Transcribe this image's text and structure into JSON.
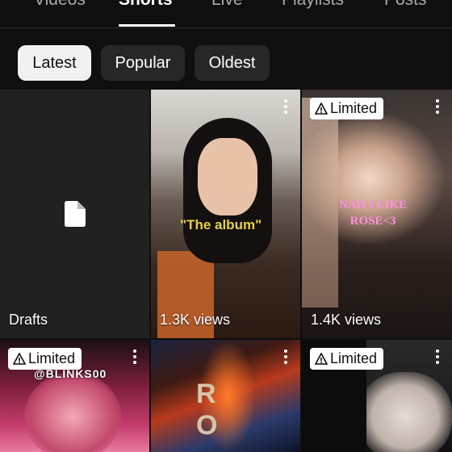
{
  "tabs": [
    {
      "label": "Videos",
      "active": false
    },
    {
      "label": "Shorts",
      "active": true
    },
    {
      "label": "Live",
      "active": false
    },
    {
      "label": "Playlists",
      "active": false
    },
    {
      "label": "Posts",
      "active": false
    }
  ],
  "filters": [
    {
      "label": "Latest",
      "active": true
    },
    {
      "label": "Popular",
      "active": false
    },
    {
      "label": "Oldest",
      "active": false
    }
  ],
  "drafts": {
    "label": "Drafts",
    "icon": "file-icon"
  },
  "shorts": [
    {
      "views": "1.3K views",
      "limited": false,
      "overlay": "\"The album\""
    },
    {
      "views": "1.4K views",
      "limited": true,
      "overlay_line1": "NAH I LIKE",
      "overlay_line2": "ROSE<3"
    },
    {
      "limited": true,
      "overlay": "@BLINKS00"
    },
    {
      "limited": false,
      "overlay": "R O"
    },
    {
      "limited": true
    }
  ],
  "badge_label": "Limited",
  "colors": {
    "background": "#0f0f0f",
    "chip_active": "#f1f1f1",
    "chip": "#272727",
    "overlay_yellow": "#e6d14a",
    "overlay_pink": "#ff8fe0"
  }
}
